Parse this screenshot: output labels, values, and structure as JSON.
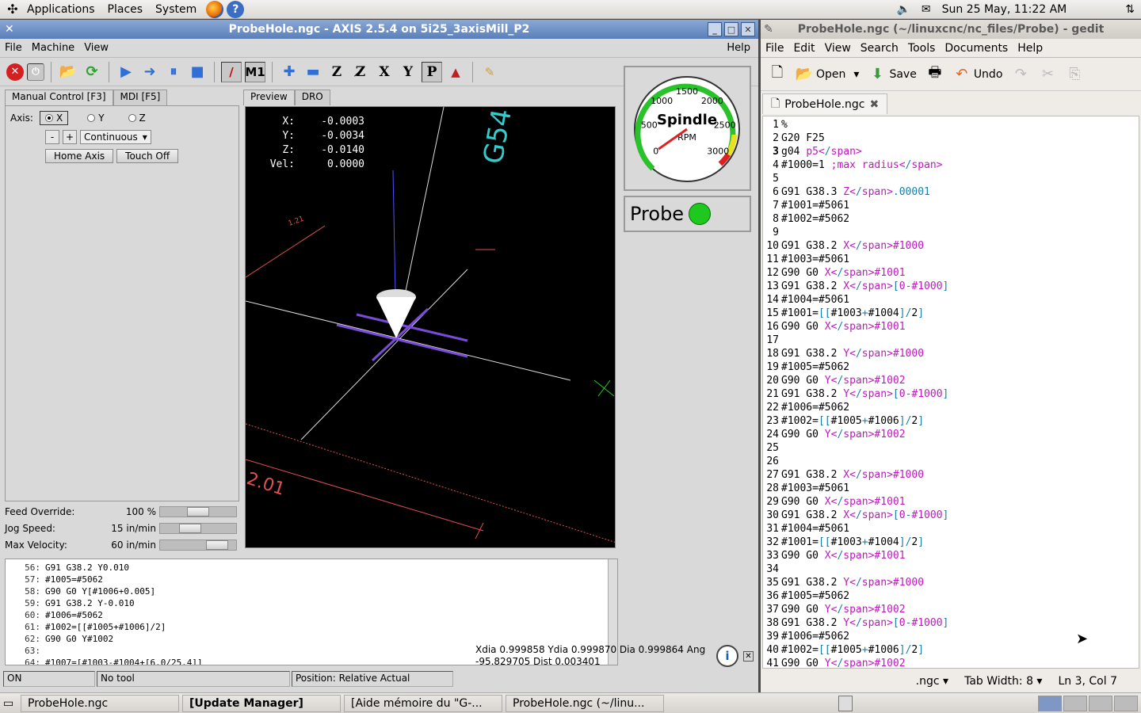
{
  "top_panel": {
    "menus": [
      "Applications",
      "Places",
      "System"
    ],
    "clock": "Sun 25 May, 11:22 AM"
  },
  "axis": {
    "title": "ProbeHole.ngc - AXIS 2.5.4 on 5i25_3axisMill_P2",
    "menu": [
      "File",
      "Machine",
      "View"
    ],
    "help": "Help",
    "tabs": [
      "Manual Control [F3]",
      "MDI [F5]"
    ],
    "axis_label": "Axis:",
    "axes": [
      "X",
      "Y",
      "Z"
    ],
    "jog_minus": "-",
    "jog_plus": "+",
    "jog_mode": "Continuous",
    "home_axis": "Home Axis",
    "touch_off": "Touch Off",
    "preview_tabs": [
      "Preview",
      "DRO"
    ],
    "dro": [
      {
        "k": "X:",
        "v": "-0.0003"
      },
      {
        "k": "Y:",
        "v": "-0.0034"
      },
      {
        "k": "Z:",
        "v": "-0.0140"
      },
      {
        "k": "Vel:",
        "v": "0.0000"
      }
    ],
    "overlay_labels": {
      "g54": "G54",
      "dim1": "1.21",
      "dim2": "2.01"
    },
    "feed_override": {
      "label": "Feed Override:",
      "value": "100 %",
      "level": 0.5
    },
    "jog_speed": {
      "label": "Jog Speed:",
      "value": "15 in/min",
      "level": 0.35
    },
    "max_velocity": {
      "label": "Max Velocity:",
      "value": "60 in/min",
      "level": 0.85
    },
    "spindle": {
      "title": "Spindle",
      "unit": "RPM",
      "ticks": [
        "0",
        "500",
        "1000",
        "1500",
        "2000",
        "2500",
        "3000"
      ],
      "rpm": 0
    },
    "probe_label": "Probe",
    "gcode_lines": [
      {
        "n": "56:",
        "t": "G91 G38.2 Y0.010"
      },
      {
        "n": "57:",
        "t": "#1005=#5062"
      },
      {
        "n": "58:",
        "t": "G90 G0 Y[#1006+0.005]"
      },
      {
        "n": "59:",
        "t": "G91 G38.2 Y-0.010"
      },
      {
        "n": "60:",
        "t": "#1006=#5062"
      },
      {
        "n": "61:",
        "t": "#1002=[[#1005+#1006]/2]"
      },
      {
        "n": "62:",
        "t": "G90 G0 Y#1002"
      },
      {
        "n": "63:",
        "t": ""
      },
      {
        "n": "64:",
        "t": "#1007=[#1003-#1004+[6.0/25.4]]"
      }
    ],
    "measure_line1": "Xdia 0.999858 Ydia 0.999870 Dia 0.999864 Ang",
    "measure_line2": "-95.829705 Dist 0.003401",
    "status": [
      "ON",
      "No tool",
      "Position: Relative Actual"
    ]
  },
  "gedit": {
    "title": "ProbeHole.ngc (~/linuxcnc/nc_files/Probe) - gedit",
    "menu": [
      "File",
      "Edit",
      "View",
      "Search",
      "Tools",
      "Documents",
      "Help"
    ],
    "open": "Open",
    "save": "Save",
    "undo": "Undo",
    "tab": "ProbeHole.ngc",
    "lines": [
      "%",
      "G20 F25",
      "g04 p5",
      "#1000=1 ;max radius",
      "",
      "G91 G38.3 Z.00001",
      "#1001=#5061",
      "#1002=#5062",
      "",
      "G91 G38.2 X#1000",
      "#1003=#5061",
      "G90 G0 X#1001",
      "G91 G38.2 X[0-#1000]",
      "#1004=#5061",
      "#1001=[[#1003+#1004]/2]",
      "G90 G0 X#1001",
      "",
      "G91 G38.2 Y#1000",
      "#1005=#5062",
      "G90 G0 Y#1002",
      "G91 G38.2 Y[0-#1000]",
      "#1006=#5062",
      "#1002=[[#1005+#1006]/2]",
      "G90 G0 Y#1002",
      "",
      "",
      "G91 G38.2 X#1000",
      "#1003=#5061",
      "G90 G0 X#1001",
      "G91 G38.2 X[0-#1000]",
      "#1004=#5061",
      "#1001=[[#1003+#1004]/2]",
      "G90 G0 X#1001",
      "",
      "G91 G38.2 Y#1000",
      "#1005=#5062",
      "G90 G0 Y#1002",
      "G91 G38.2 Y[0-#1000]",
      "#1006=#5062",
      "#1002=[[#1005+#1006]/2]",
      "G90 G0 Y#1002"
    ],
    "lang": ".ngc",
    "tab_width": "Tab Width: 8",
    "cursor": "Ln 3, Col 7"
  },
  "taskbar": [
    {
      "label": "ProbeHole.ngc",
      "bold": false
    },
    {
      "label": "[Update Manager]",
      "bold": true
    },
    {
      "label": "[Aide mémoire du \"G-...",
      "bold": false
    },
    {
      "label": "ProbeHole.ngc (~/linu...",
      "bold": false
    }
  ]
}
